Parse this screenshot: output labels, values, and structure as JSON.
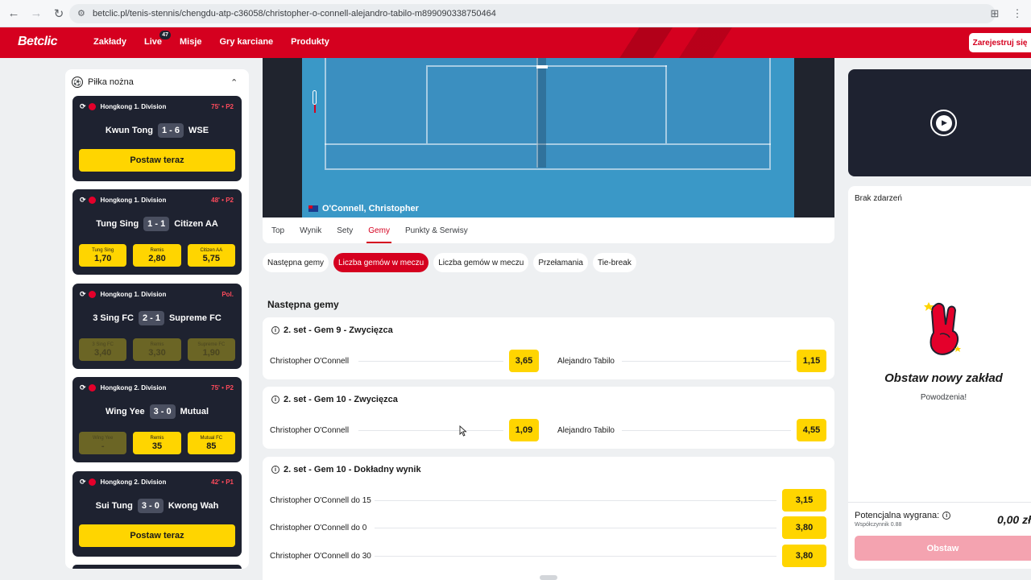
{
  "browser": {
    "url": "betclic.pl/tenis-stennis/chengdu-atp-c36058/christopher-o-connell-alejandro-tabilo-m899090338750464",
    "icons": [
      "back-icon",
      "forward-icon",
      "reload-icon",
      "site-info-icon",
      "install-icon",
      "more-icon"
    ]
  },
  "header": {
    "logo": "Betclic",
    "nav": [
      {
        "label": "Zakłady"
      },
      {
        "label": "Live",
        "badge": "47"
      },
      {
        "label": "Misje"
      },
      {
        "label": "Gry karciane"
      },
      {
        "label": "Produkty"
      }
    ],
    "register": "Zarejestruj się",
    "brand_color": "#d5001f"
  },
  "sidebar": {
    "sport": "Piłka nożna",
    "matches": [
      {
        "league": "Hongkong 1. Division",
        "time": "75' • P2",
        "home": "Kwun Tong",
        "score": "1 - 6",
        "away": "WSE",
        "cta": "Postaw teraz"
      },
      {
        "league": "Hongkong 1. Division",
        "time": "48' • P2",
        "home": "Tung Sing",
        "score": "1 - 1",
        "away": "Citizen AA",
        "odds": [
          {
            "label": "Tung Sing",
            "value": "1,70"
          },
          {
            "label": "Remis",
            "value": "2,80"
          },
          {
            "label": "Citizen AA",
            "value": "5,75"
          }
        ]
      },
      {
        "league": "Hongkong 1. Division",
        "time": "Pol.",
        "home": "3 Sing FC",
        "score": "2 - 1",
        "away": "Supreme FC",
        "odds": [
          {
            "label": "3 Sing FC",
            "value": "3,40"
          },
          {
            "label": "Remis",
            "value": "3,30"
          },
          {
            "label": "Supreme FC",
            "value": "1,90"
          }
        ]
      },
      {
        "league": "Hongkong 2. Division",
        "time": "75' • P2",
        "home": "Wing Yee",
        "score": "3 - 0",
        "away": "Mutual",
        "odds": [
          {
            "label": "Wing Yee",
            "value": "-"
          },
          {
            "label": "Remis",
            "value": "35"
          },
          {
            "label": "Mutual FC",
            "value": "85"
          }
        ]
      },
      {
        "league": "Hongkong 2. Division",
        "time": "42' • P1",
        "home": "Sui Tung",
        "score": "3 - 0",
        "away": "Kwong Wah",
        "cta": "Postaw teraz"
      }
    ]
  },
  "stream": {
    "player": "O'Connell, Christopher"
  },
  "tabs": [
    {
      "label": "Top"
    },
    {
      "label": "Wynik"
    },
    {
      "label": "Sety"
    },
    {
      "label": "Gemy",
      "active": true
    },
    {
      "label": "Punkty & Serwisy"
    }
  ],
  "chips": [
    {
      "label": "Następna gemy"
    },
    {
      "label": "Liczba gemów w meczu",
      "active": true
    },
    {
      "label": "Liczba gemów w meczu"
    },
    {
      "label": "Przełamania"
    },
    {
      "label": "Tie-break"
    }
  ],
  "section_title": "Następna gemy",
  "markets": [
    {
      "title": "2. set - Gem 9 - Zwycięzca",
      "selections": [
        {
          "name": "Christopher O'Connell",
          "odd": "3,65"
        },
        {
          "name": "Alejandro Tabilo",
          "odd": "1,15"
        }
      ]
    },
    {
      "title": "2. set - Gem 10 - Zwycięzca",
      "selections": [
        {
          "name": "Christopher O'Connell",
          "odd": "1,09"
        },
        {
          "name": "Alejandro Tabilo",
          "odd": "4,55"
        }
      ]
    },
    {
      "title": "2. set - Gem 10 - Dokładny wynik",
      "selections": [
        {
          "name": "Christopher O'Connell do 15",
          "odd": "3,15"
        },
        {
          "name": "Christopher O'Connell do 0",
          "odd": "3,80"
        },
        {
          "name": "Christopher O'Connell do 30",
          "odd": "3,80"
        }
      ]
    }
  ],
  "betslip": {
    "no_events": "Brak zdarzeń",
    "promo_title": "Obstaw nowy zakład",
    "promo_sub": "Powodzenia!",
    "potential_label": "Potencjalna wygrana:",
    "coefficient": "Współczynnik 0.88",
    "potential_value": "0,00 zł",
    "place_bet": "Obstaw"
  }
}
